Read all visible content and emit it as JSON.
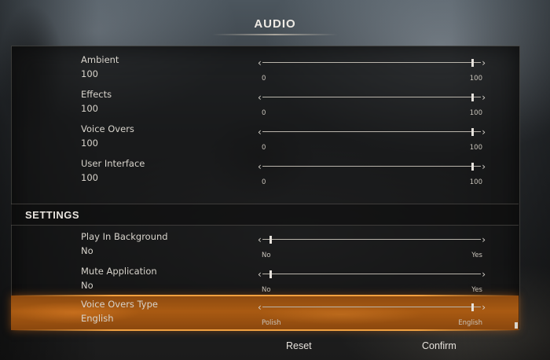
{
  "header": {
    "title": "AUDIO"
  },
  "audio_rows": [
    {
      "label": "Ambient",
      "value": "100",
      "min": "0",
      "max": "100",
      "level": 1.0
    },
    {
      "label": "Effects",
      "value": "100",
      "min": "0",
      "max": "100",
      "level": 1.0
    },
    {
      "label": "Voice Overs",
      "value": "100",
      "min": "0",
      "max": "100",
      "level": 1.0
    },
    {
      "label": "User Interface",
      "value": "100",
      "min": "0",
      "max": "100",
      "level": 1.0
    }
  ],
  "settings": {
    "title": "SETTINGS",
    "rows": [
      {
        "label": "Play In Background",
        "value": "No",
        "min": "No",
        "max": "Yes",
        "level": 0.0
      },
      {
        "label": "Mute Application",
        "value": "No",
        "min": "No",
        "max": "Yes",
        "level": 0.0
      },
      {
        "label": "Voice Overs Type",
        "value": "English",
        "min": "Polish",
        "max": "English",
        "level": 1.0,
        "selected": true
      }
    ]
  },
  "footer": {
    "reset_label": "Reset",
    "confirm_label": "Confirm"
  },
  "icons": {
    "arrow_left": "arrow-left-icon",
    "arrow_right": "arrow-right-icon"
  },
  "colors": {
    "accent": "#a95a12",
    "text": "#d8d4cc"
  }
}
